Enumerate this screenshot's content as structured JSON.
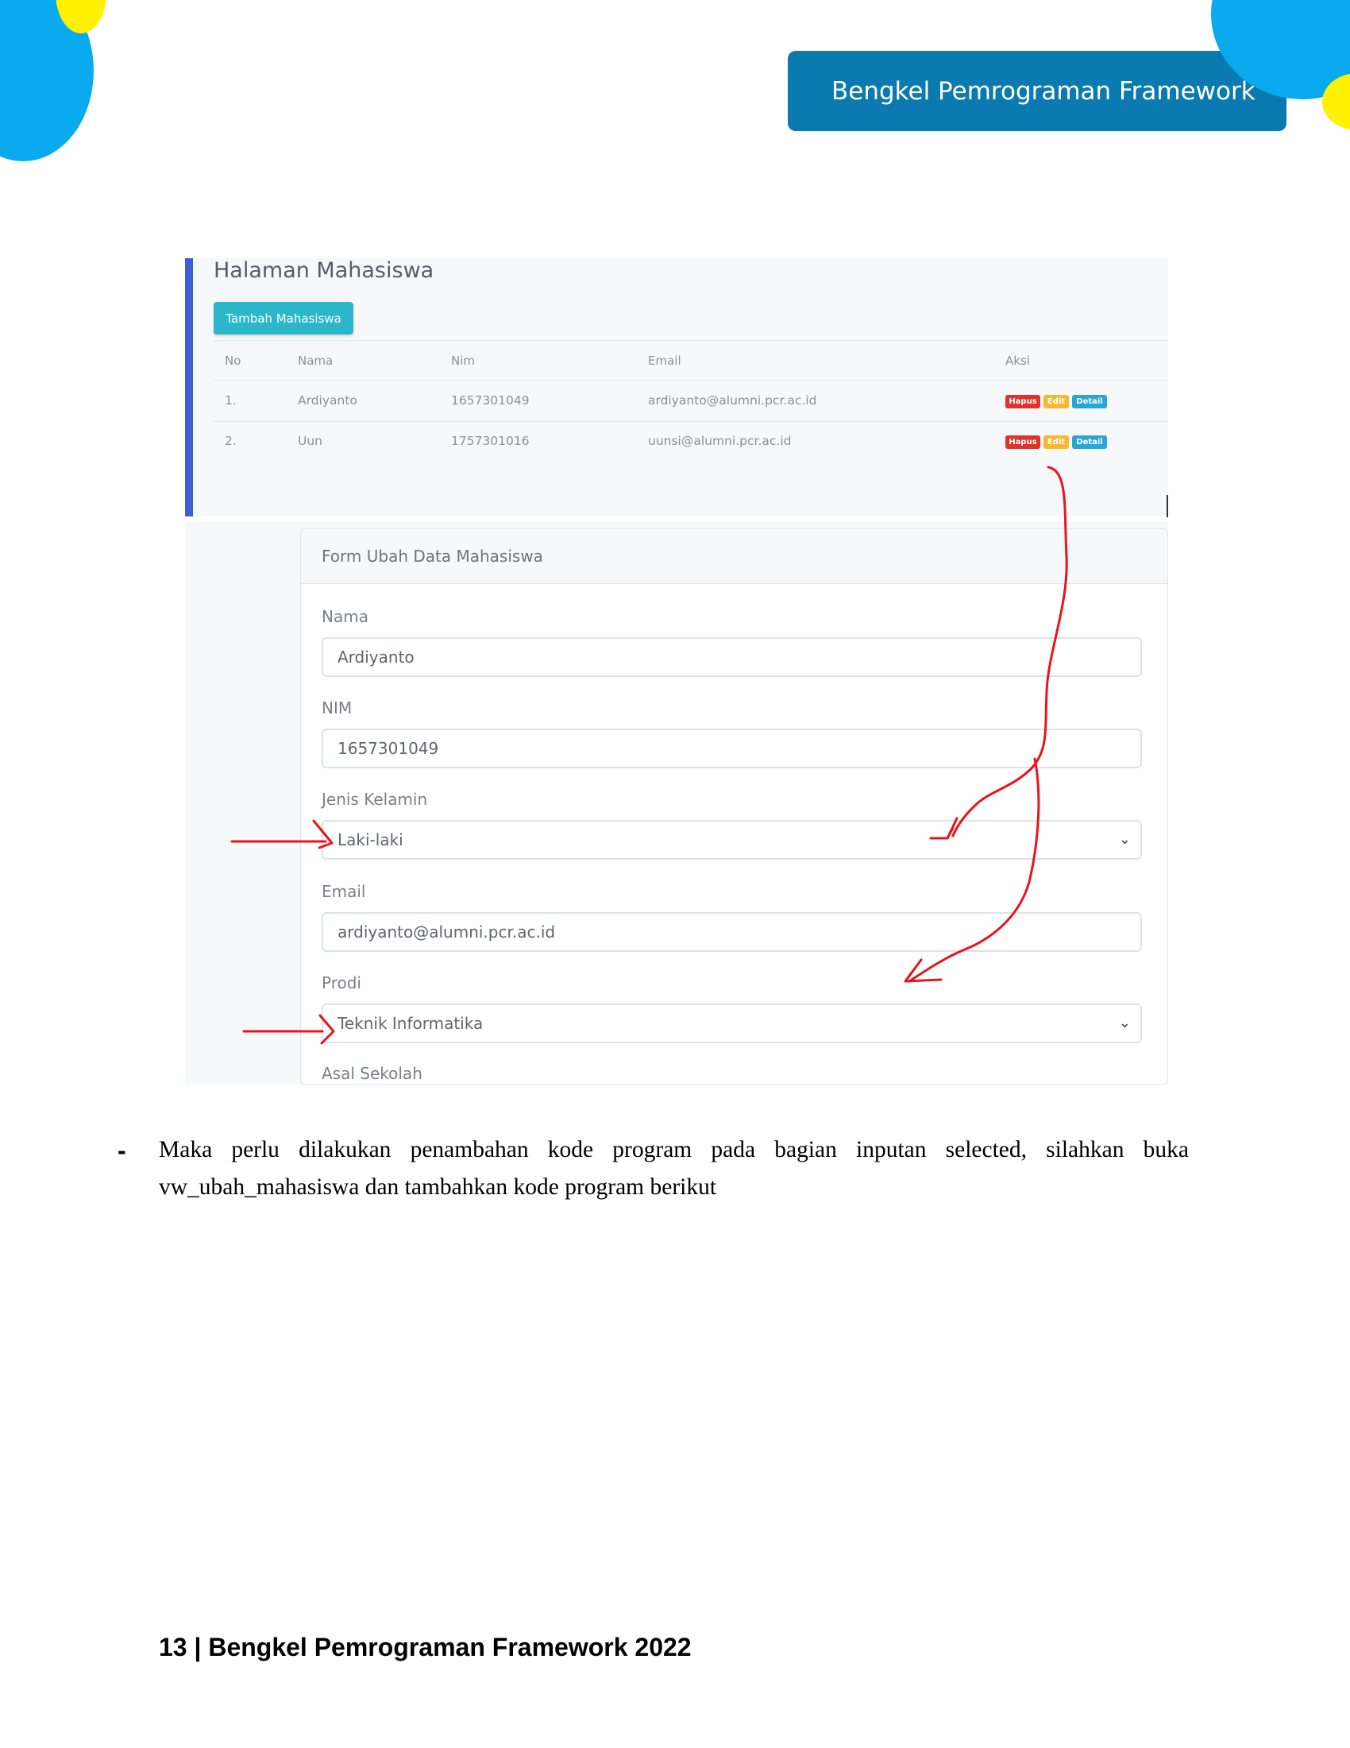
{
  "header": {
    "banner_title": "Bengkel Pemrograman Framework"
  },
  "screenshot": {
    "list_page": {
      "title": "Halaman Mahasiswa",
      "add_button": "Tambah Mahasiswa",
      "columns": [
        "No",
        "Nama",
        "Nim",
        "Email",
        "Aksi"
      ],
      "rows": [
        {
          "no": "1.",
          "nama": "Ardiyanto",
          "nim": "1657301049",
          "email": "ardiyanto@alumni.pcr.ac.id"
        },
        {
          "no": "2.",
          "nama": "Uun",
          "nim": "1757301016",
          "email": "uunsi@alumni.pcr.ac.id"
        }
      ],
      "actions": {
        "delete": "Hapus",
        "edit": "Edit",
        "detail": "Detail"
      }
    },
    "form": {
      "title": "Form Ubah Data Mahasiswa",
      "nama_label": "Nama",
      "nama_value": "Ardiyanto",
      "nim_label": "NIM",
      "nim_value": "1657301049",
      "jk_label": "Jenis Kelamin",
      "jk_value": "Laki-laki",
      "email_label": "Email",
      "email_value": "ardiyanto@alumni.pcr.ac.id",
      "prodi_label": "Prodi",
      "prodi_value": "Teknik Informatika",
      "asal_label": "Asal Sekolah"
    },
    "annotation_color": "#e8141b"
  },
  "body": {
    "bullet": "-",
    "paragraph": "Maka perlu dilakukan penambahan kode program pada bagian inputan selected, silahkan buka vw_ubah_mahasiswa dan tambahkan kode program berikut"
  },
  "footer": {
    "text": "13 | Bengkel Pemrograman Framework 2022"
  }
}
